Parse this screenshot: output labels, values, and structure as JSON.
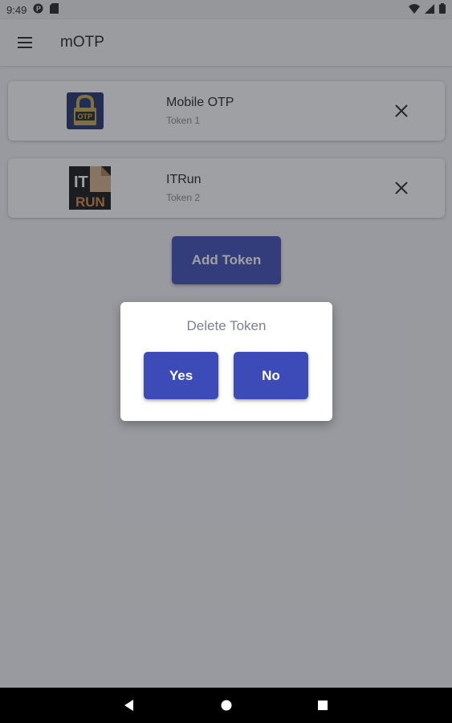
{
  "status_bar": {
    "time": "9:49",
    "icons": [
      "p-badge-icon",
      "sd-card-icon",
      "wifi-icon",
      "cell-signal-icon",
      "battery-icon"
    ]
  },
  "app_bar": {
    "title": "mOTP",
    "menu_icon": "hamburger-menu-icon"
  },
  "tokens": [
    {
      "name": "Mobile OTP",
      "subtitle": "Token 1",
      "logo": "lock-otp-logo"
    },
    {
      "name": "ITRun",
      "subtitle": "Token 2",
      "logo": "itrun-logo"
    }
  ],
  "add_button": {
    "label": "Add Token"
  },
  "dialog": {
    "title": "Delete Token",
    "yes_label": "Yes",
    "no_label": "No"
  },
  "logo_text": {
    "otp": "OTP",
    "it": "IT",
    "run": "RUN"
  },
  "nav_bar": {
    "icons": [
      "back-icon",
      "home-icon",
      "recents-icon"
    ]
  },
  "colors": {
    "accent": "#3c4bb8",
    "scrim": "#282c32",
    "dialog_title": "#7b7f99"
  }
}
